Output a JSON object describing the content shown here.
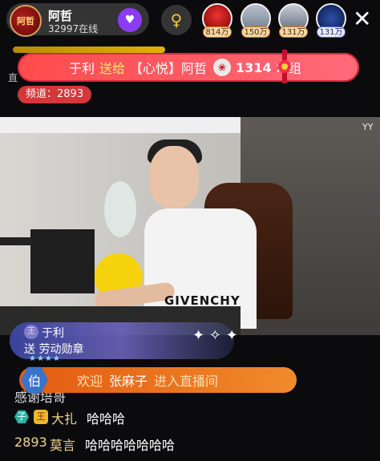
{
  "host": {
    "name": "阿哲",
    "viewers": "32997在线",
    "avatar_text": "阿哲"
  },
  "ranks": [
    {
      "badge": "814万"
    },
    {
      "badge": "150万"
    },
    {
      "badge": "131万"
    },
    {
      "badge": "131万"
    }
  ],
  "banner": {
    "sender": "于利",
    "verb": "送给",
    "target": "【心悦】阿哲",
    "count": "1314",
    "unit": "x",
    "group": "组"
  },
  "channel": {
    "label": "频道：2893"
  },
  "video": {
    "watermark": "YY",
    "shirt_text": "GIVENCHY"
  },
  "gift_notice": {
    "badge": "王",
    "user": "于利",
    "text": "送 劳动勋章",
    "stars": "★★★★"
  },
  "welcome": {
    "badge": "伯",
    "prefix": "欢迎",
    "name": "张麻子",
    "suffix": "进入直播间"
  },
  "chat": [
    {
      "partial": "感谢培哥"
    },
    {
      "badge": "子",
      "crown": "王",
      "name": "大扎",
      "message": "哈哈哈"
    },
    {
      "level": "2893",
      "name": "莫言",
      "message": "哈哈哈哈哈哈哈"
    }
  ],
  "colors": {
    "banner": "#ff5555",
    "welcome": "#ef7a22",
    "channel": "#d5373a"
  }
}
